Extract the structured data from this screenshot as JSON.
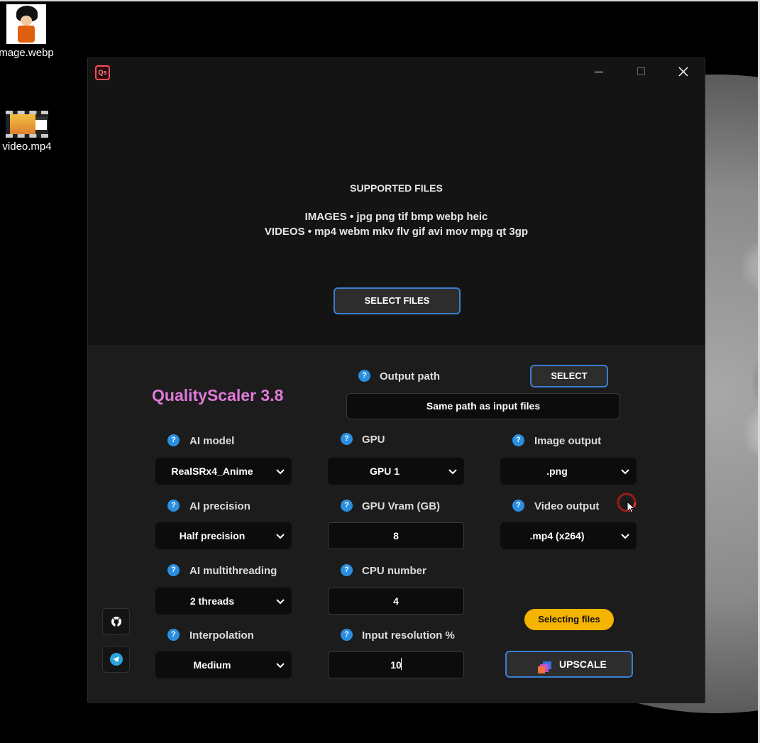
{
  "desktop": {
    "icons": [
      {
        "label": "mage.webp",
        "icon": "image-file-thumbnail"
      },
      {
        "label": "video.mp4",
        "icon": "video-file-thumbnail"
      }
    ]
  },
  "window": {
    "controls": {
      "minimize": "minimize",
      "maximize": "maximize",
      "close": "close"
    }
  },
  "drop_zone": {
    "title": "SUPPORTED FILES",
    "images_line": "IMAGES • jpg png tif bmp webp heic",
    "videos_line": "VIDEOS • mp4 webm mkv flv gif avi mov mpg qt 3gp",
    "select_files_label": "SELECT FILES"
  },
  "settings": {
    "app_title": "QualityScaler 3.8",
    "help_glyph": "?",
    "output_path": {
      "label": "Output path",
      "select_label": "SELECT",
      "value": "Same path as input files"
    },
    "ai_model": {
      "label": "AI model",
      "value": "RealSRx4_Anime"
    },
    "ai_precision": {
      "label": "AI precision",
      "value": "Half precision"
    },
    "ai_multithreading": {
      "label": "AI multithreading",
      "value": "2 threads"
    },
    "interpolation": {
      "label": "Interpolation",
      "value": "Medium"
    },
    "gpu": {
      "label": "GPU",
      "value": "GPU 1"
    },
    "gpu_vram": {
      "label": "GPU Vram (GB)",
      "value": "8"
    },
    "cpu_number": {
      "label": "CPU number",
      "value": "4"
    },
    "input_resolution": {
      "label": "Input resolution %",
      "value": "10"
    },
    "image_output": {
      "label": "Image output",
      "value": ".png"
    },
    "video_output": {
      "label": "Video output",
      "value": ".mp4 (x264)"
    },
    "status": "Selecting files",
    "upscale_label": "UPSCALE"
  },
  "colors": {
    "accent_blue": "#3b7fd1",
    "title_pink": "#e07ad9",
    "status_yellow": "#f5b400",
    "help_blue": "#2a8fe0",
    "close_red": "#ff4d5a"
  }
}
